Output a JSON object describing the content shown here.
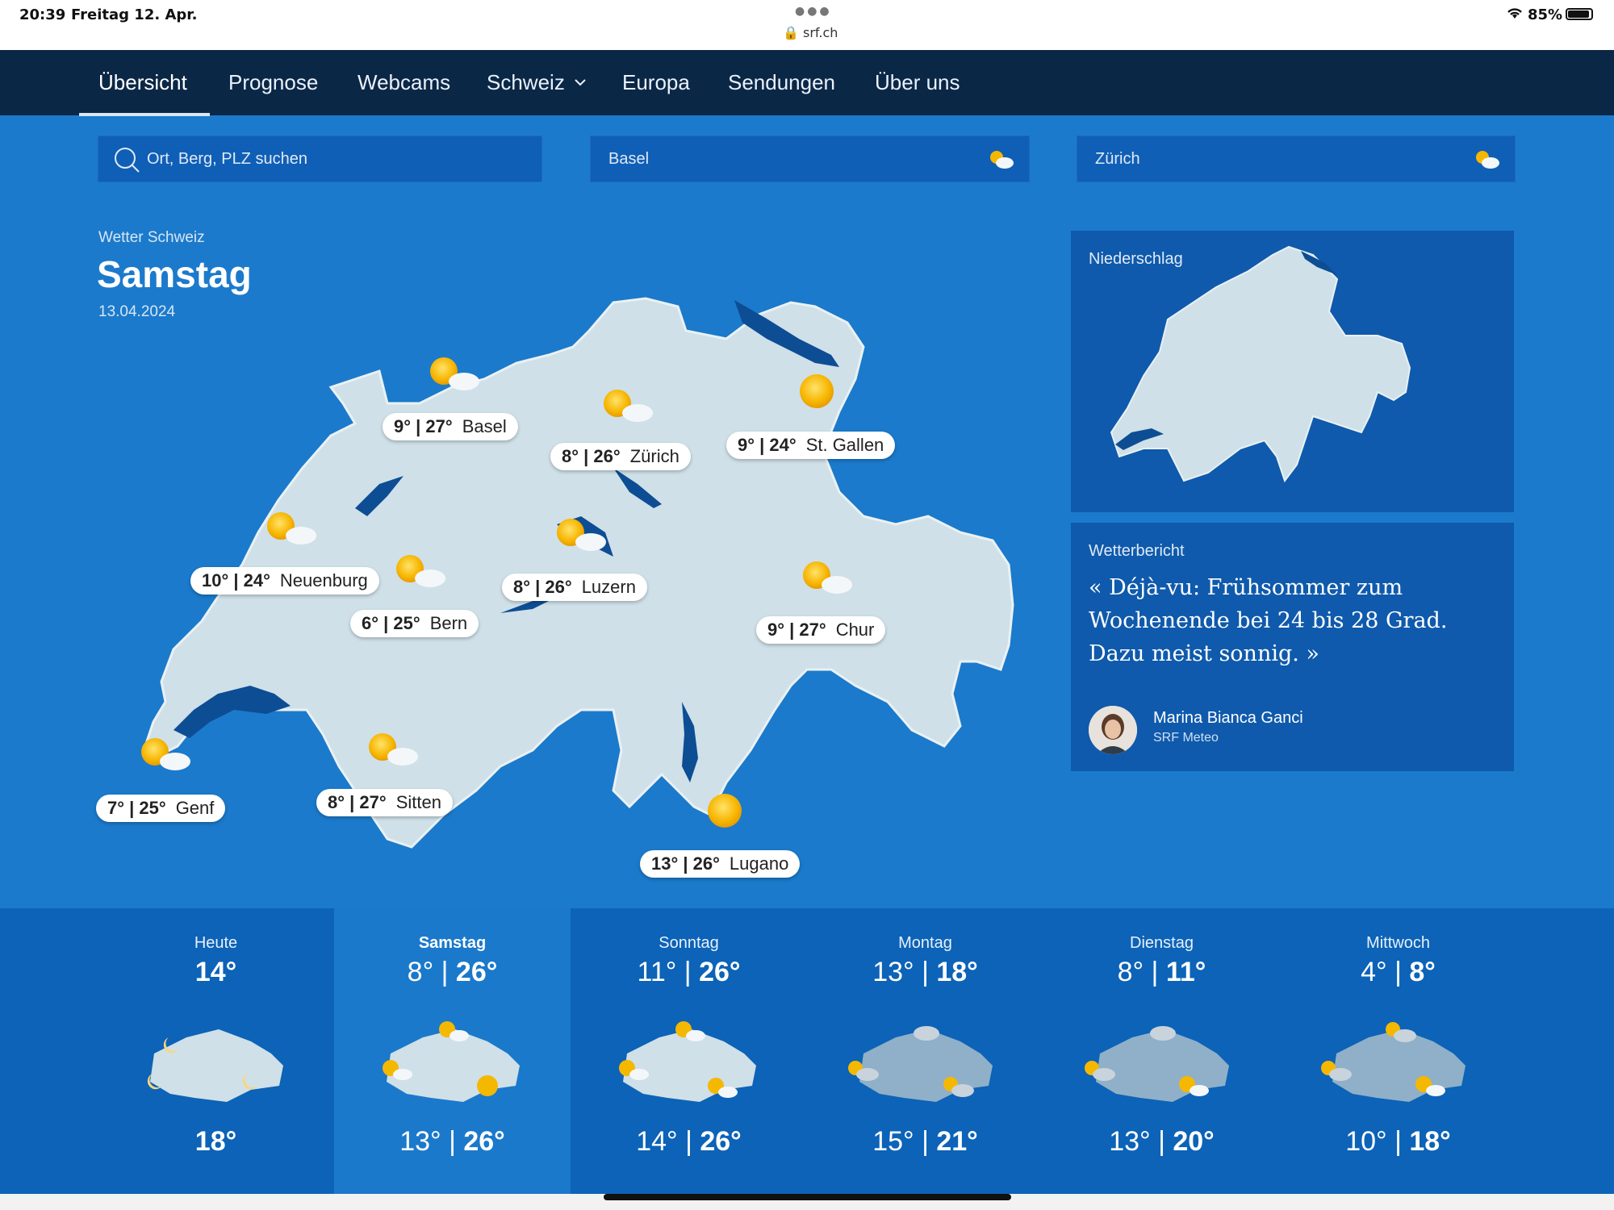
{
  "status": {
    "time": "20:39",
    "date": "Freitag 12. Apr.",
    "url": "srf.ch",
    "battery": "85%"
  },
  "nav": {
    "items": [
      {
        "label": "Übersicht",
        "active": true
      },
      {
        "label": "Prognose"
      },
      {
        "label": "Webcams"
      },
      {
        "label": "Schweiz"
      },
      {
        "label": "Europa"
      },
      {
        "label": "Sendungen"
      },
      {
        "label": "Über uns"
      }
    ]
  },
  "search": {
    "placeholder": "Ort, Berg, PLZ suchen",
    "fav1": "Basel",
    "fav2": "Zürich"
  },
  "heading": {
    "section": "Wetter Schweiz",
    "day": "Samstag",
    "date": "13.04.2024"
  },
  "cities": [
    {
      "temps": "9° | 27°",
      "name": "Basel",
      "icon": "sun-cloud"
    },
    {
      "temps": "8° | 26°",
      "name": "Zürich",
      "icon": "sun-cloud"
    },
    {
      "temps": "9° | 24°",
      "name": "St. Gallen",
      "icon": "sun"
    },
    {
      "temps": "10° | 24°",
      "name": "Neuenburg",
      "icon": "sun-cloud"
    },
    {
      "temps": "6° | 25°",
      "name": "Bern",
      "icon": "sun-cloud"
    },
    {
      "temps": "8° | 26°",
      "name": "Luzern",
      "icon": "sun-cloud"
    },
    {
      "temps": "9° | 27°",
      "name": "Chur",
      "icon": "sun-cloud"
    },
    {
      "temps": "7° | 25°",
      "name": "Genf",
      "icon": "sun-cloud"
    },
    {
      "temps": "8° | 27°",
      "name": "Sitten",
      "icon": "sun-cloud"
    },
    {
      "temps": "13° | 26°",
      "name": "Lugano",
      "icon": "sun"
    }
  ],
  "precip_card": {
    "label": "Niederschlag"
  },
  "report": {
    "label": "Wetterbericht",
    "quote": "« Déjà-vu: Frühsommer zum Wochenende bei 24 bis 28 Grad. Dazu meist sonnig. »",
    "author": "Marina Bianca Ganci",
    "author_org": "SRF Meteo"
  },
  "days": [
    {
      "name": "Heute",
      "top_a": "",
      "top_b": "14°",
      "bot_a": "",
      "bot_b": "18°",
      "selected": false
    },
    {
      "name": "Samstag",
      "top_a": "8° | ",
      "top_b": "26°",
      "bot_a": "13° | ",
      "bot_b": "26°",
      "selected": true
    },
    {
      "name": "Sonntag",
      "top_a": "11° | ",
      "top_b": "26°",
      "bot_a": "14° | ",
      "bot_b": "26°",
      "selected": false
    },
    {
      "name": "Montag",
      "top_a": "13° | ",
      "top_b": "18°",
      "bot_a": "15° | ",
      "bot_b": "21°",
      "selected": false
    },
    {
      "name": "Dienstag",
      "top_a": "8° | ",
      "top_b": "11°",
      "bot_a": "13° | ",
      "bot_b": "20°",
      "selected": false
    },
    {
      "name": "Mittwoch",
      "top_a": "4° | ",
      "top_b": "8°",
      "bot_a": "10° | ",
      "bot_b": "18°",
      "selected": false
    }
  ],
  "colors": {
    "background": "#1b7acb",
    "nav": "#0b2746",
    "card": "#0f5aac",
    "sun": "#f5b800"
  }
}
